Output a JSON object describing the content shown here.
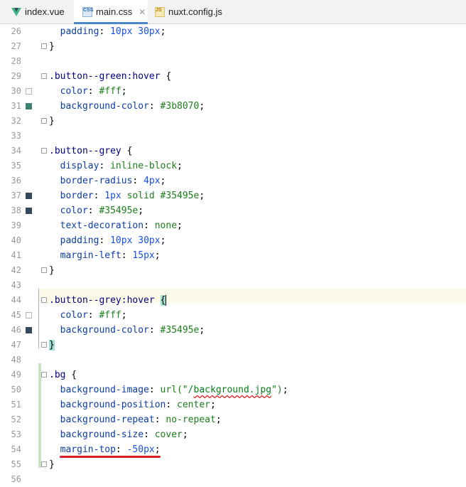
{
  "tabs": [
    {
      "label": "index.vue",
      "icon": "vue-icon",
      "active": false
    },
    {
      "label": "main.css",
      "icon": "css-file-icon",
      "active": true,
      "icon_text": "CSS"
    },
    {
      "label": "nuxt.config.js",
      "icon": "js-file-icon",
      "active": false,
      "icon_text": "JS"
    }
  ],
  "close_glyph": "✕",
  "lines": [
    {
      "n": "26",
      "code": [
        {
          "c": "prop",
          "t": "  padding"
        },
        {
          "c": "punct",
          "t": ": "
        },
        {
          "c": "num",
          "t": "10"
        },
        {
          "c": "unit",
          "t": "px "
        },
        {
          "c": "num",
          "t": "30"
        },
        {
          "c": "unit",
          "t": "px"
        },
        {
          "c": "punct",
          "t": ";"
        }
      ]
    },
    {
      "n": "27",
      "code": [
        {
          "c": "punct",
          "t": "}"
        }
      ]
    },
    {
      "n": "28",
      "code": []
    },
    {
      "n": "29",
      "code": [
        {
          "c": "sel",
          "t": ".button--green:hover"
        },
        {
          "c": "punct",
          "t": " {"
        }
      ]
    },
    {
      "n": "30",
      "code": [
        {
          "c": "prop",
          "t": "  color"
        },
        {
          "c": "punct",
          "t": ": "
        },
        {
          "c": "val",
          "t": "#fff"
        },
        {
          "c": "punct",
          "t": ";"
        }
      ]
    },
    {
      "n": "31",
      "code": [
        {
          "c": "prop",
          "t": "  background-color"
        },
        {
          "c": "punct",
          "t": ": "
        },
        {
          "c": "val",
          "t": "#3b8070"
        },
        {
          "c": "punct",
          "t": ";"
        }
      ]
    },
    {
      "n": "32",
      "code": [
        {
          "c": "punct",
          "t": "}"
        }
      ]
    },
    {
      "n": "33",
      "code": []
    },
    {
      "n": "34",
      "code": [
        {
          "c": "sel",
          "t": ".button--grey"
        },
        {
          "c": "punct",
          "t": " {"
        }
      ]
    },
    {
      "n": "35",
      "code": [
        {
          "c": "prop",
          "t": "  display"
        },
        {
          "c": "punct",
          "t": ": "
        },
        {
          "c": "val",
          "t": "inline-block"
        },
        {
          "c": "punct",
          "t": ";"
        }
      ]
    },
    {
      "n": "36",
      "code": [
        {
          "c": "prop",
          "t": "  border-radius"
        },
        {
          "c": "punct",
          "t": ": "
        },
        {
          "c": "num",
          "t": "4"
        },
        {
          "c": "unit",
          "t": "px"
        },
        {
          "c": "punct",
          "t": ";"
        }
      ]
    },
    {
      "n": "37",
      "code": [
        {
          "c": "prop",
          "t": "  border"
        },
        {
          "c": "punct",
          "t": ": "
        },
        {
          "c": "num",
          "t": "1"
        },
        {
          "c": "unit",
          "t": "px "
        },
        {
          "c": "val",
          "t": "solid #35495e"
        },
        {
          "c": "punct",
          "t": ";"
        }
      ]
    },
    {
      "n": "38",
      "code": [
        {
          "c": "prop",
          "t": "  color"
        },
        {
          "c": "punct",
          "t": ": "
        },
        {
          "c": "val",
          "t": "#35495e"
        },
        {
          "c": "punct",
          "t": ";"
        }
      ]
    },
    {
      "n": "39",
      "code": [
        {
          "c": "prop",
          "t": "  text-decoration"
        },
        {
          "c": "punct",
          "t": ": "
        },
        {
          "c": "val",
          "t": "none"
        },
        {
          "c": "punct",
          "t": ";"
        }
      ]
    },
    {
      "n": "40",
      "code": [
        {
          "c": "prop",
          "t": "  padding"
        },
        {
          "c": "punct",
          "t": ": "
        },
        {
          "c": "num",
          "t": "10"
        },
        {
          "c": "unit",
          "t": "px "
        },
        {
          "c": "num",
          "t": "30"
        },
        {
          "c": "unit",
          "t": "px"
        },
        {
          "c": "punct",
          "t": ";"
        }
      ]
    },
    {
      "n": "41",
      "code": [
        {
          "c": "prop",
          "t": "  margin-left"
        },
        {
          "c": "punct",
          "t": ": "
        },
        {
          "c": "num",
          "t": "15"
        },
        {
          "c": "unit",
          "t": "px"
        },
        {
          "c": "punct",
          "t": ";"
        }
      ]
    },
    {
      "n": "42",
      "code": [
        {
          "c": "punct",
          "t": "}"
        }
      ]
    },
    {
      "n": "43",
      "code": []
    },
    {
      "n": "44",
      "code": [
        {
          "c": "sel",
          "t": ".button--grey:hover"
        },
        {
          "c": "punct",
          "t": " "
        },
        {
          "c": "brace",
          "t": "{"
        }
      ]
    },
    {
      "n": "45",
      "code": [
        {
          "c": "prop",
          "t": "  color"
        },
        {
          "c": "punct",
          "t": ": "
        },
        {
          "c": "val",
          "t": "#fff"
        },
        {
          "c": "punct",
          "t": ";"
        }
      ]
    },
    {
      "n": "46",
      "code": [
        {
          "c": "prop",
          "t": "  background-color"
        },
        {
          "c": "punct",
          "t": ": "
        },
        {
          "c": "val",
          "t": "#35495e"
        },
        {
          "c": "punct",
          "t": ";"
        }
      ]
    },
    {
      "n": "47",
      "code": [
        {
          "c": "brace",
          "t": "}"
        }
      ]
    },
    {
      "n": "48",
      "code": []
    },
    {
      "n": "49",
      "code": [
        {
          "c": "sel",
          "t": ".bg"
        },
        {
          "c": "punct",
          "t": " {"
        }
      ]
    },
    {
      "n": "50",
      "code": [
        {
          "c": "prop",
          "t": "  background-image"
        },
        {
          "c": "punct",
          "t": ": "
        },
        {
          "c": "val",
          "t": "url("
        },
        {
          "c": "str",
          "t": "\"/"
        },
        {
          "c": "strsq",
          "t": "background.jpg"
        },
        {
          "c": "str",
          "t": "\""
        },
        {
          "c": "val",
          "t": ")"
        },
        {
          "c": "punct",
          "t": ";"
        }
      ]
    },
    {
      "n": "51",
      "code": [
        {
          "c": "prop",
          "t": "  background-position"
        },
        {
          "c": "punct",
          "t": ": "
        },
        {
          "c": "val",
          "t": "center"
        },
        {
          "c": "punct",
          "t": ";"
        }
      ]
    },
    {
      "n": "52",
      "code": [
        {
          "c": "prop",
          "t": "  background-repeat"
        },
        {
          "c": "punct",
          "t": ": "
        },
        {
          "c": "val",
          "t": "no-repeat"
        },
        {
          "c": "punct",
          "t": ";"
        }
      ]
    },
    {
      "n": "53",
      "code": [
        {
          "c": "prop",
          "t": "  background-size"
        },
        {
          "c": "punct",
          "t": ": "
        },
        {
          "c": "val",
          "t": "cover"
        },
        {
          "c": "punct",
          "t": ";"
        }
      ]
    },
    {
      "n": "54",
      "code": [
        {
          "c": "prop",
          "t": "  margin-top"
        },
        {
          "c": "punct",
          "t": ": "
        },
        {
          "c": "num",
          "t": "-50"
        },
        {
          "c": "unit",
          "t": "px"
        },
        {
          "c": "punct",
          "t": ";"
        }
      ]
    },
    {
      "n": "55",
      "code": [
        {
          "c": "punct",
          "t": "}"
        }
      ]
    },
    {
      "n": "56",
      "code": []
    }
  ],
  "swatches": {
    "30": "#ffffff",
    "31": "#3b8070",
    "37": "#35495e",
    "38": "#35495e",
    "45": "#ffffff",
    "46": "#35495e"
  },
  "colors": {
    "accent": "#4a86c8",
    "annotation_red": "#d42020",
    "brace_match": "#9fe0d4",
    "changed_lines": "#c9e4c0"
  }
}
